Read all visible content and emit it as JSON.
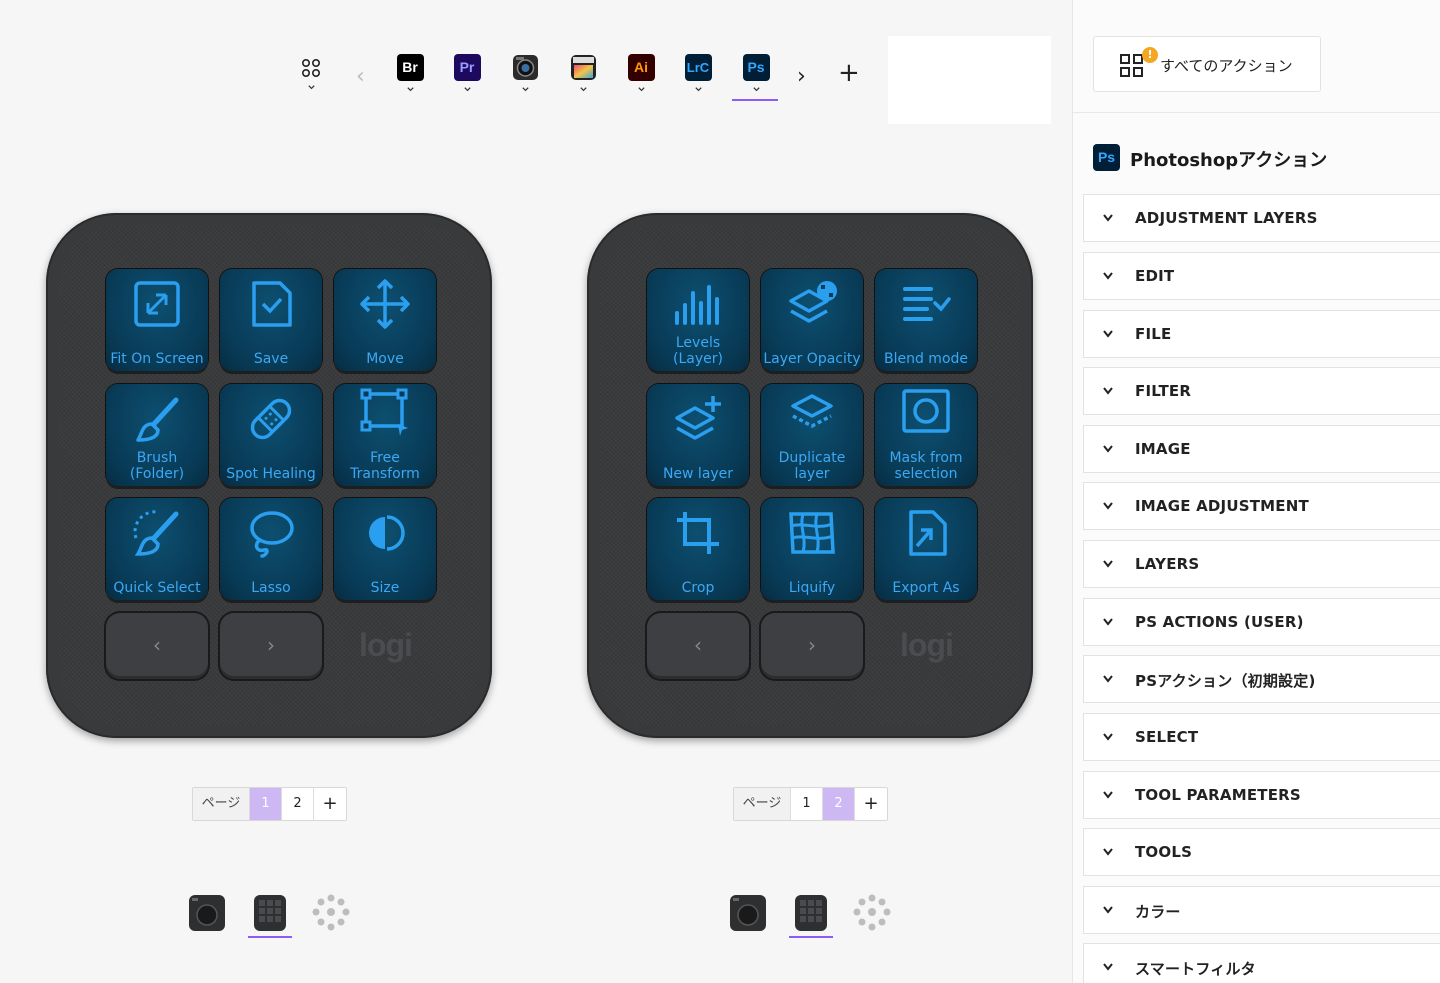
{
  "toolbar": {
    "apps": [
      {
        "name": "all-apps",
        "label": ""
      },
      {
        "name": "bridge",
        "label": "Br",
        "bg": "#000000",
        "fg": "#ffffff"
      },
      {
        "name": "premiere",
        "label": "Pr",
        "bg": "#1d0a5f",
        "fg": "#9a9cff"
      },
      {
        "name": "camera-app",
        "label": ""
      },
      {
        "name": "final-cut",
        "label": ""
      },
      {
        "name": "illustrator",
        "label": "Ai",
        "bg": "#330000",
        "fg": "#ff9a00"
      },
      {
        "name": "lightroom-classic",
        "label": "LrC",
        "bg": "#001e36",
        "fg": "#31a8ff"
      },
      {
        "name": "photoshop",
        "label": "Ps",
        "bg": "#001e36",
        "fg": "#31a8ff"
      }
    ],
    "selected": "photoshop",
    "prev": "‹",
    "next": "›",
    "add": "+"
  },
  "devices": [
    {
      "keys": [
        {
          "label": "Fit On Screen",
          "icon": "fit-screen-icon"
        },
        {
          "label": "Save",
          "icon": "save-icon"
        },
        {
          "label": "Move",
          "icon": "move-icon"
        },
        {
          "label": "Brush (Folder)",
          "icon": "brush-icon"
        },
        {
          "label": "Spot Healing",
          "icon": "bandage-icon"
        },
        {
          "label": "Free Transform",
          "icon": "transform-icon"
        },
        {
          "label": "Quick Select",
          "icon": "quick-select-icon"
        },
        {
          "label": "Lasso",
          "icon": "lasso-icon"
        },
        {
          "label": "Size",
          "icon": "size-icon"
        }
      ],
      "nav_prev": "‹",
      "nav_next": "›",
      "logo": "logi",
      "pager": {
        "label": "ページ",
        "pages": [
          "1",
          "2"
        ],
        "active": 0,
        "add": "+"
      }
    },
    {
      "keys": [
        {
          "label": "Levels (Layer)",
          "icon": "levels-icon"
        },
        {
          "label": "Layer Opacity",
          "icon": "layer-opacity-icon"
        },
        {
          "label": "Blend mode",
          "icon": "blend-mode-icon"
        },
        {
          "label": "New layer",
          "icon": "new-layer-icon"
        },
        {
          "label": "Duplicate layer",
          "icon": "duplicate-layer-icon"
        },
        {
          "label": "Mask from selection",
          "icon": "mask-icon"
        },
        {
          "label": "Crop",
          "icon": "crop-icon"
        },
        {
          "label": "Liquify",
          "icon": "liquify-icon"
        },
        {
          "label": "Export As",
          "icon": "export-icon"
        }
      ],
      "nav_prev": "‹",
      "nav_next": "›",
      "logo": "logi",
      "pager": {
        "label": "ページ",
        "pages": [
          "1",
          "2"
        ],
        "active": 1,
        "add": "+"
      }
    }
  ],
  "panel": {
    "all_actions": "すべてのアクション",
    "badge": "!",
    "app_icon": "Ps",
    "app_title": "Photoshopアクション",
    "categories": [
      "ADJUSTMENT LAYERS",
      "EDIT",
      "FILE",
      "FILTER",
      "IMAGE",
      "IMAGE ADJUSTMENT",
      "LAYERS",
      "PS ACTIONS (USER)",
      "PSアクション（初期設定)",
      "SELECT",
      "TOOL PARAMETERS",
      "TOOLS",
      "カラー",
      "スマートフィルタ"
    ]
  },
  "colors": {
    "accent": "#8b5cf6",
    "key_text": "#3ba8f5",
    "page_active": "#cdb8f3",
    "badge": "#f5a623"
  }
}
